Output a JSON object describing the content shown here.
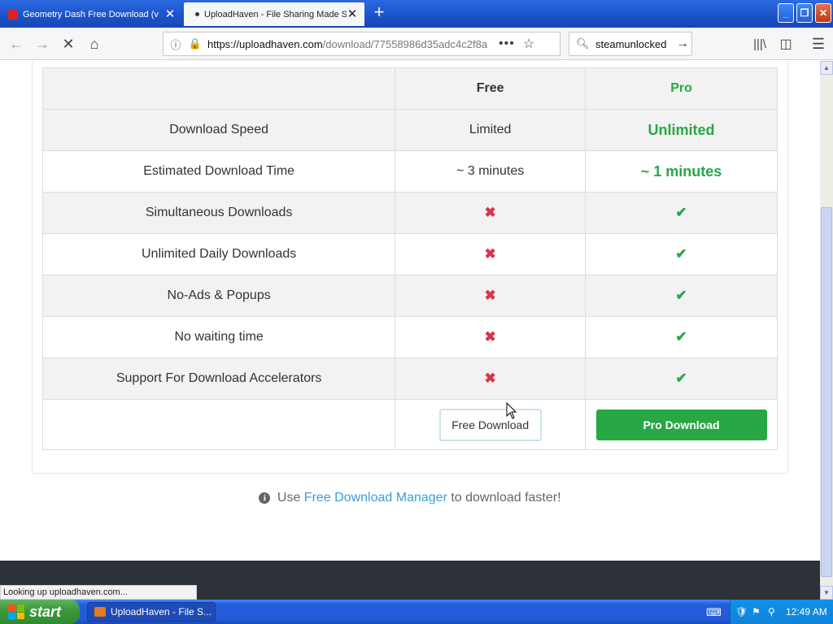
{
  "browser": {
    "tabs": [
      {
        "label": "Geometry Dash Free Download (v",
        "active": false
      },
      {
        "label": "UploadHaven - File Sharing Made S",
        "active": true
      }
    ],
    "url_host": "https://uploadhaven.com",
    "url_rest": "/download/77558986d35adc4c2f8a",
    "search_value": "steamunlocked",
    "status": "Looking up uploadhaven.com..."
  },
  "comparison": {
    "header": {
      "free": "Free",
      "pro": "Pro"
    },
    "rows": [
      {
        "feature": "Download Speed",
        "free": "Limited",
        "pro": "Unlimited"
      },
      {
        "feature": "Estimated Download Time",
        "free": "~ 3 minutes",
        "pro": "~ 1 minutes"
      },
      {
        "feature": "Simultaneous Downloads",
        "free": "✖",
        "pro": "✔"
      },
      {
        "feature": "Unlimited Daily Downloads",
        "free": "✖",
        "pro": "✔"
      },
      {
        "feature": "No-Ads & Popups",
        "free": "✖",
        "pro": "✔"
      },
      {
        "feature": "No waiting time",
        "free": "✖",
        "pro": "✔"
      },
      {
        "feature": "Support For Download Accelerators",
        "free": "✖",
        "pro": "✔"
      }
    ],
    "free_button": "Free Download",
    "pro_button": "Pro Download"
  },
  "note": {
    "prefix": "Use",
    "link": "Free Download Manager",
    "suffix": "to download faster!"
  },
  "taskbar": {
    "start_label": "start",
    "window_label": "UploadHaven - File S...",
    "clock": "12:49 AM"
  },
  "colors": {
    "pro_green": "#28a745",
    "cross_red": "#d9344a",
    "link_blue": "#3a9fd6"
  }
}
